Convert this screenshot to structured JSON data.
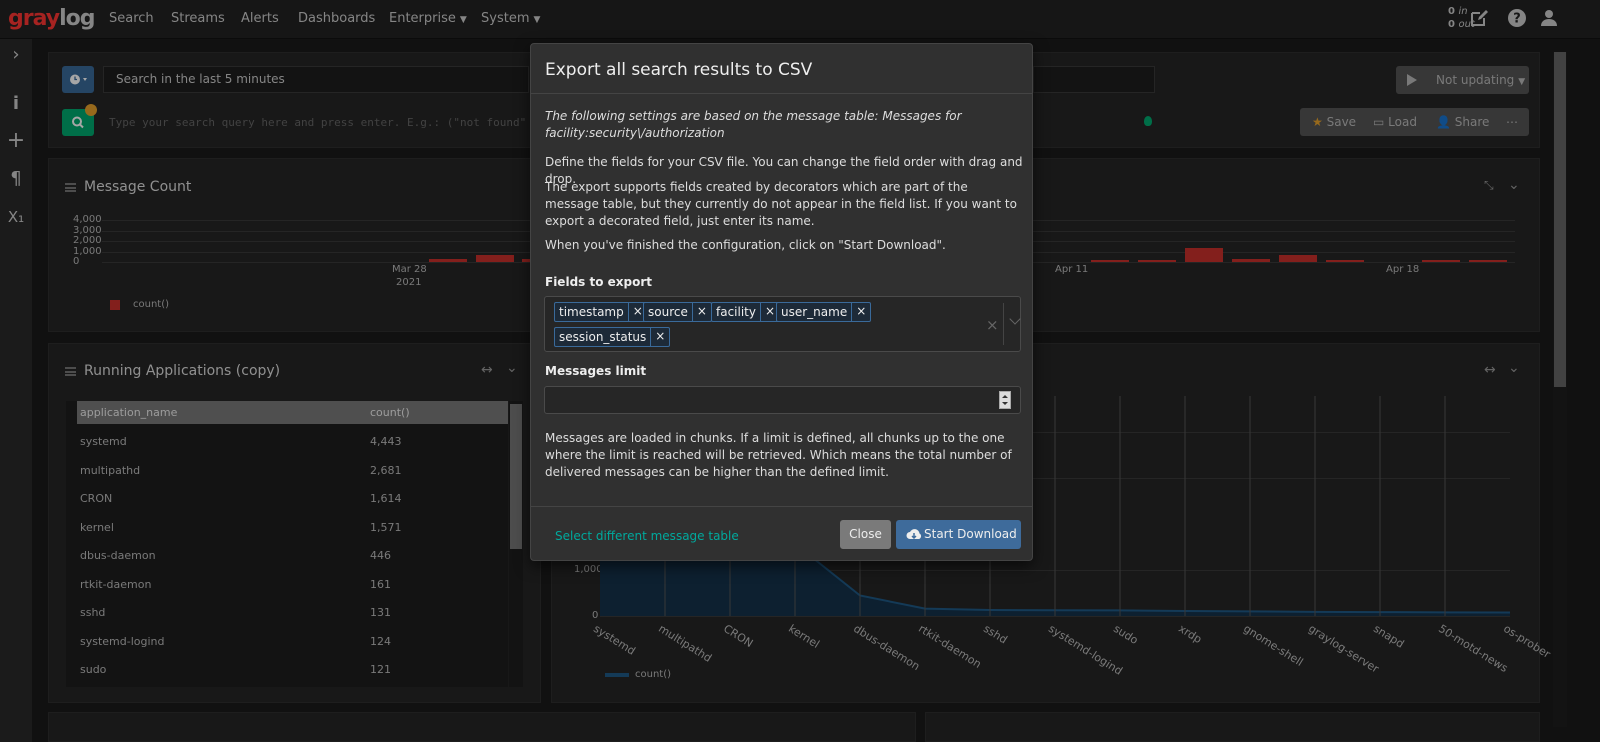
{
  "nav": {
    "logo_red": "gray",
    "logo_gray": "log",
    "items": [
      "Search",
      "Streams",
      "Alerts",
      "Dashboards",
      "Enterprise",
      "System"
    ],
    "throughput_in_value": "0",
    "throughput_in_label": "in",
    "throughput_out_value": "0",
    "throughput_out_label": "out"
  },
  "search": {
    "time_range": "Search in the last 5 minutes",
    "query_placeholder": "Type your search query here and press enter. E.g.: (\"not found\"",
    "refresh_label": "Not updating",
    "save_label": "Save",
    "load_label": "Load",
    "share_label": "Share",
    "more_label": "⋯"
  },
  "message_count": {
    "title": "Message Count",
    "legend": "count()"
  },
  "chart_data": [
    {
      "type": "bar",
      "title": "Message Count",
      "y_ticks": [
        "4,000",
        "3,000",
        "2,000",
        "1,000",
        "0"
      ],
      "x_ticks": [
        "Mar 28",
        "Apr 11",
        "Apr 18"
      ],
      "x_tick_sub": "2021",
      "series": [
        {
          "name": "count()",
          "values": [
            150,
            300,
            100,
            80,
            600,
            120,
            300,
            90,
            60,
            120,
            80
          ]
        }
      ]
    },
    {
      "type": "area",
      "categories": [
        "systemd",
        "multipathd",
        "CRON",
        "kernel",
        "dbus-daemon",
        "rtkit-daemon",
        "sshd",
        "systemd-logind",
        "sudo",
        "xrdp",
        "gnome-shell",
        "graylog-server",
        "snapd",
        "50-motd-news",
        "os-prober"
      ],
      "series": [
        {
          "name": "count()",
          "values": [
            4443,
            2681,
            1614,
            1571,
            446,
            161,
            131,
            124,
            121,
            110,
            100,
            90,
            85,
            80,
            75
          ]
        }
      ],
      "y_ticks": [
        "1,000",
        "0"
      ]
    }
  ],
  "running_apps": {
    "title": "Running Applications (copy)",
    "columns": [
      "application_name",
      "count()"
    ],
    "rows": [
      [
        "systemd",
        "4,443"
      ],
      [
        "multipathd",
        "2,681"
      ],
      [
        "CRON",
        "1,614"
      ],
      [
        "kernel",
        "1,571"
      ],
      [
        "dbus-daemon",
        "446"
      ],
      [
        "rtkit-daemon",
        "161"
      ],
      [
        "sshd",
        "131"
      ],
      [
        "systemd-logind",
        "124"
      ],
      [
        "sudo",
        "121"
      ]
    ],
    "legend": "count()"
  },
  "modal": {
    "title": "Export all search results to CSV",
    "intro": "The following settings are based on the message table: Messages for facility:security\\/authorization",
    "p1": "Define the fields for your CSV file. You can change the field order with drag and drop.",
    "p2": "The export supports fields created by decorators which are part of the message table, but they currently do not appear in the field list. If you want to export a decorated field, just enter its name.",
    "p3": "When you've finished the configuration, click on \"Start Download\".",
    "fields_label": "Fields to export",
    "fields": [
      "timestamp",
      "source",
      "facility",
      "user_name",
      "session_status"
    ],
    "limit_label": "Messages limit",
    "limit_value": "",
    "chunks_note": "Messages are loaded in chunks. If a limit is defined, all chunks up to the one where the limit is reached will be retrieved. Which means the total number of delivered messages can be higher than the defined limit.",
    "select_table_link": "Select different message table",
    "close_label": "Close",
    "download_label": "Start Download"
  }
}
